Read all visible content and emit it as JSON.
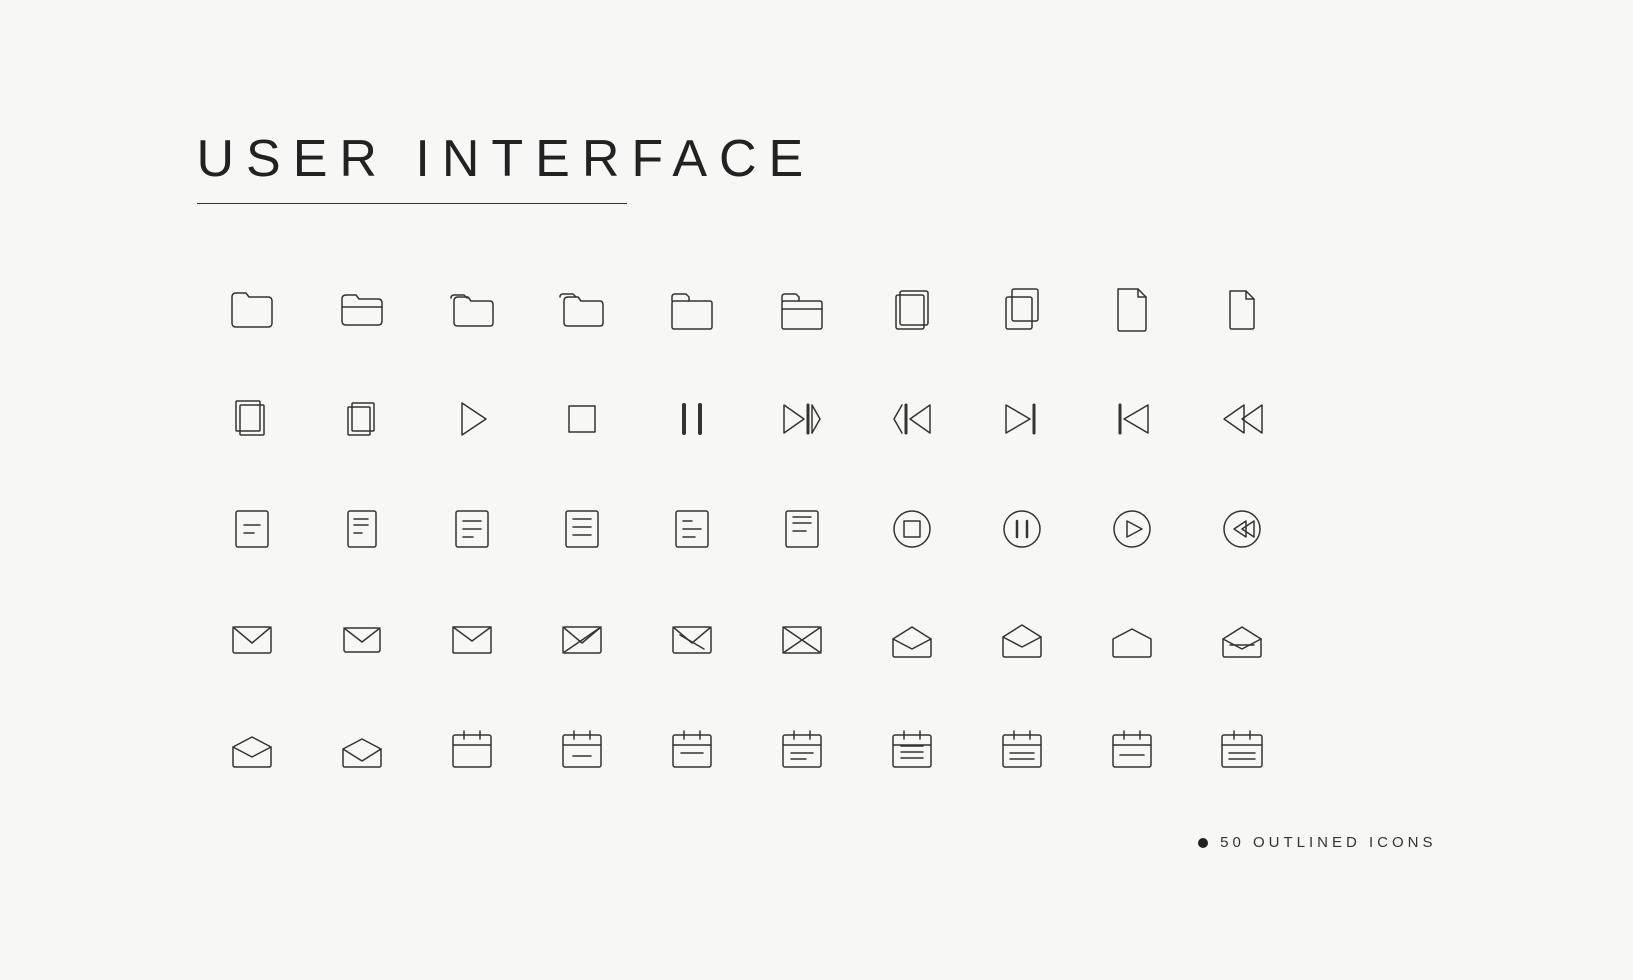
{
  "title": "USER INTERFACE",
  "footer": {
    "label": "50 OUTLINED ICONS"
  },
  "icons": [
    {
      "name": "folder-simple",
      "row": 1
    },
    {
      "name": "folder-open",
      "row": 1
    },
    {
      "name": "folder-stacked",
      "row": 1
    },
    {
      "name": "folder-double",
      "row": 1
    },
    {
      "name": "folder-tab",
      "row": 1
    },
    {
      "name": "folder-tab-open",
      "row": 1
    },
    {
      "name": "copy-pages",
      "row": 1
    },
    {
      "name": "copy-pages-2",
      "row": 1
    },
    {
      "name": "document",
      "row": 1
    },
    {
      "name": "document-small",
      "row": 1
    },
    {
      "name": "document-copy",
      "row": 2
    },
    {
      "name": "document-copy-2",
      "row": 2
    },
    {
      "name": "play",
      "row": 2
    },
    {
      "name": "stop-square",
      "row": 2
    },
    {
      "name": "pause",
      "row": 2
    },
    {
      "name": "skip-forward",
      "row": 2
    },
    {
      "name": "skip-back",
      "row": 2
    },
    {
      "name": "step-forward",
      "row": 2
    },
    {
      "name": "step-back",
      "row": 2
    },
    {
      "name": "rewind",
      "row": 2
    },
    {
      "name": "file-minus",
      "row": 3
    },
    {
      "name": "file-minus-2",
      "row": 3
    },
    {
      "name": "file-list",
      "row": 3
    },
    {
      "name": "file-list-2",
      "row": 3
    },
    {
      "name": "file-list-3",
      "row": 3
    },
    {
      "name": "file-list-4",
      "row": 3
    },
    {
      "name": "circle-stop",
      "row": 3
    },
    {
      "name": "circle-pause",
      "row": 3
    },
    {
      "name": "circle-play",
      "row": 3
    },
    {
      "name": "circle-rewind",
      "row": 3
    },
    {
      "name": "mail-closed-1",
      "row": 4
    },
    {
      "name": "mail-closed-2",
      "row": 4
    },
    {
      "name": "mail-closed-3",
      "row": 4
    },
    {
      "name": "mail-x-1",
      "row": 4
    },
    {
      "name": "mail-x-2",
      "row": 4
    },
    {
      "name": "mail-x-3",
      "row": 4
    },
    {
      "name": "mail-open-1",
      "row": 4
    },
    {
      "name": "mail-open-2",
      "row": 4
    },
    {
      "name": "mail-open-3",
      "row": 4
    },
    {
      "name": "mail-open-x",
      "row": 4
    },
    {
      "name": "mail-open-bottom-1",
      "row": 5
    },
    {
      "name": "mail-open-bottom-2",
      "row": 5
    },
    {
      "name": "calendar-empty",
      "row": 5
    },
    {
      "name": "calendar-minus",
      "row": 5
    },
    {
      "name": "calendar-simple",
      "row": 5
    },
    {
      "name": "calendar-lines",
      "row": 5
    },
    {
      "name": "calendar-full",
      "row": 5
    },
    {
      "name": "calendar-detail",
      "row": 5
    },
    {
      "name": "calendar-remove",
      "row": 5
    },
    {
      "name": "calendar-wide",
      "row": 5
    }
  ]
}
